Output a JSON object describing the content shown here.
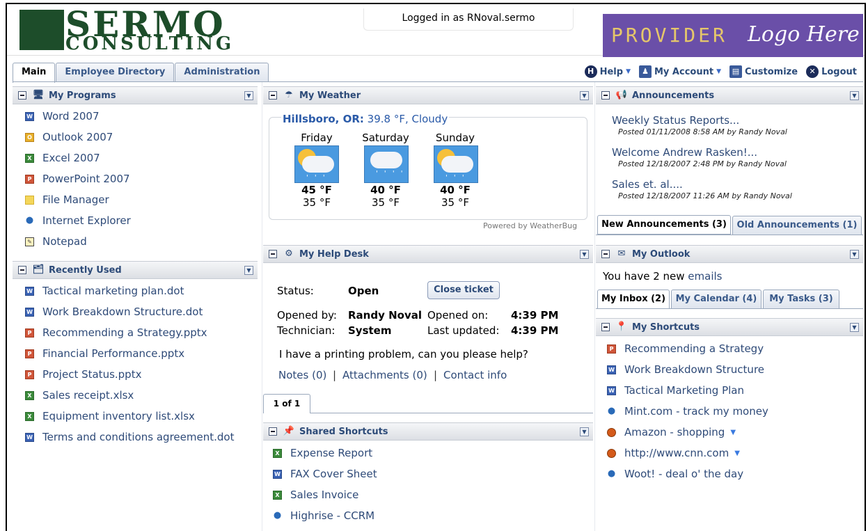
{
  "header": {
    "logo_line1": "SERMO",
    "logo_line2": "CONSULTING",
    "logged_in": "Logged in as RNoval.sermo",
    "provider_word": "PROVIDER",
    "provider_script": "Logo Here"
  },
  "tabs": [
    {
      "label": "Main",
      "active": true
    },
    {
      "label": "Employee Directory",
      "active": false
    },
    {
      "label": "Administration",
      "active": false
    }
  ],
  "toplinks": {
    "help": "Help",
    "my_account": "My Account",
    "customize": "Customize",
    "logout": "Logout"
  },
  "programs": {
    "title": "My Programs",
    "items": [
      "Word 2007",
      "Outlook 2007",
      "Excel 2007",
      "PowerPoint 2007",
      "File Manager",
      "Internet Explorer",
      "Notepad"
    ]
  },
  "recent": {
    "title": "Recently Used",
    "items": [
      "Tactical marketing plan.dot",
      "Work Breakdown Structure.dot",
      "Recommending a Strategy.pptx",
      "Financial Performance.pptx",
      "Project Status.pptx",
      "Sales receipt.xlsx",
      "Equipment inventory list.xlsx",
      "Terms and conditions agreement.dot"
    ]
  },
  "weather": {
    "title": "My Weather",
    "location": "Hillsboro, OR:",
    "current": "39.8 °F, Cloudy",
    "days": [
      {
        "name": "Friday",
        "hi": "45 °F",
        "lo": "35 °F"
      },
      {
        "name": "Saturday",
        "hi": "40 °F",
        "lo": "35 °F"
      },
      {
        "name": "Sunday",
        "hi": "40 °F",
        "lo": "35 °F"
      }
    ],
    "powered": "Powered by WeatherBug"
  },
  "helpdesk": {
    "title": "My Help Desk",
    "status_label": "Status:",
    "status_value": "Open",
    "close_button": "Close ticket",
    "opened_by_label": "Opened by:",
    "opened_by_value": "Randy Noval",
    "opened_on_label": "Opened on:",
    "opened_on_value": "4:39 PM",
    "technician_label": "Technician:",
    "technician_value": "System",
    "updated_label": "Last updated:",
    "updated_value": "4:39 PM",
    "message": "I have a printing problem, can you please help?",
    "notes": "Notes (0)",
    "attachments": "Attachments (0)",
    "contact": "Contact info",
    "sep": "|",
    "pager": "1 of 1"
  },
  "shared": {
    "title": "Shared Shortcuts",
    "items": [
      "Expense Report",
      "FAX Cover Sheet",
      "Sales Invoice",
      "Highrise - CCRM"
    ]
  },
  "announcements": {
    "title": "Announcements",
    "items": [
      {
        "title": "Weekly Status Reports...",
        "meta": "Posted 01/11/2008 8:58 AM by Randy Noval"
      },
      {
        "title": "Welcome Andrew Rasken!...",
        "meta": "Posted 12/18/2007 2:48 PM by Randy Noval"
      },
      {
        "title": "Sales et. al....",
        "meta": "Posted 12/18/2007 11:26 AM by Randy Noval"
      }
    ],
    "tab_new": "New Announcements (3)",
    "tab_old": "Old Announcements (1)"
  },
  "outlook": {
    "title": "My Outlook",
    "text_prefix": "You have 2 new",
    "text_link": "emails",
    "tab_inbox": "My Inbox (2)",
    "tab_calendar": "My Calendar (4)",
    "tab_tasks": "My Tasks (3)"
  },
  "shortcuts": {
    "title": "My Shortcuts",
    "items": [
      "Recommending a Strategy",
      "Work Breakdown Structure",
      "Tactical Marketing Plan",
      "Mint.com - track my money",
      "Amazon - shopping",
      "http://www.cnn.com",
      "Woot! - deal o' the day"
    ]
  },
  "colors": {
    "accent": "#2e4a78",
    "brand_green": "#1d4d2a",
    "provider_bg": "#6a4fa8"
  }
}
